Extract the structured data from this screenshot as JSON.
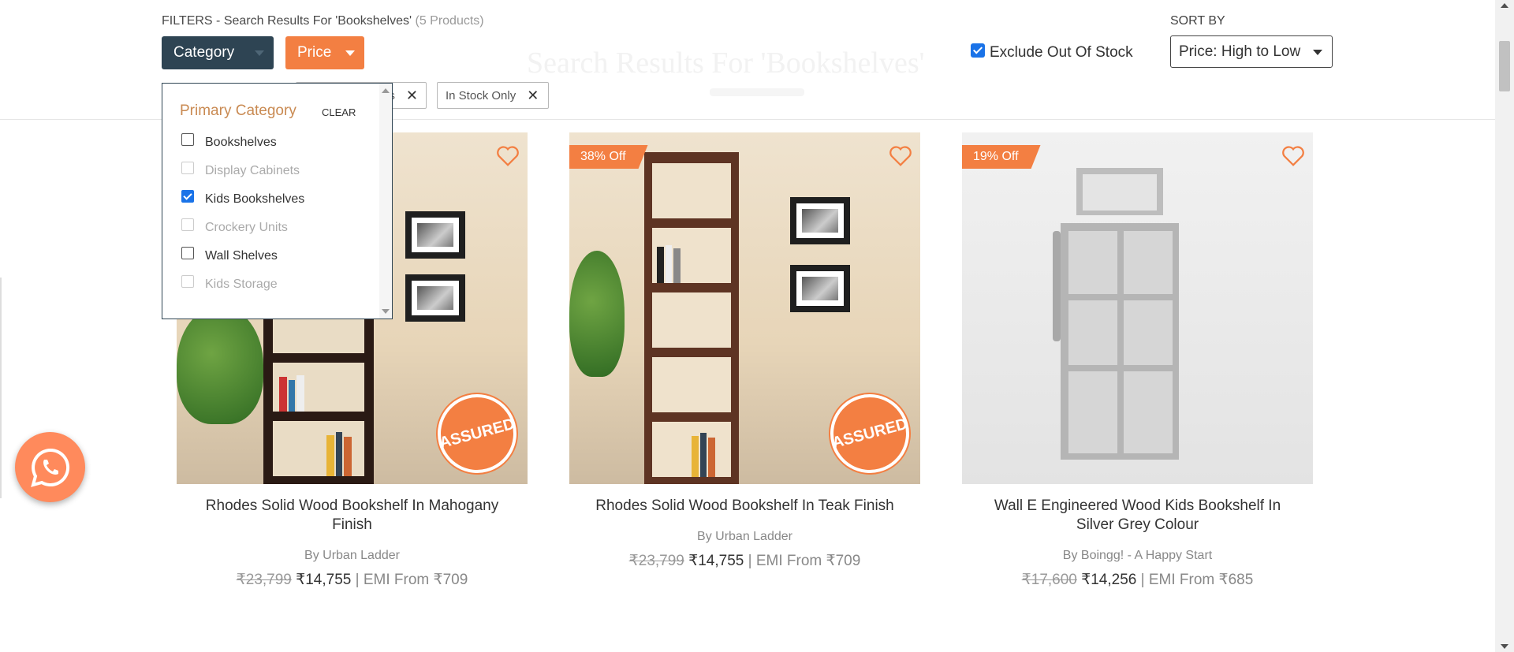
{
  "header": {
    "filters_label": "FILTERS - Search Results For 'Bookshelves'",
    "product_count": "(5 Products)",
    "ghost_title": "Search Results For 'Bookshelves'"
  },
  "filter_buttons": {
    "category": "Category",
    "price": "Price"
  },
  "active_chips": {
    "prev_suffix": "s",
    "in_stock": "In Stock Only"
  },
  "exclude_out_of_stock": {
    "label": "Exclude Out Of Stock",
    "checked": true
  },
  "sort": {
    "label": "SORT BY",
    "value": "Price: High to Low"
  },
  "category_dropdown": {
    "heading": "Primary Category",
    "clear": "CLEAR",
    "items": [
      {
        "label": "Bookshelves",
        "checked": false,
        "disabled": false
      },
      {
        "label": "Display Cabinets",
        "checked": false,
        "disabled": true
      },
      {
        "label": "Kids Bookshelves",
        "checked": true,
        "disabled": false
      },
      {
        "label": "Crockery Units",
        "checked": false,
        "disabled": true
      },
      {
        "label": "Wall Shelves",
        "checked": false,
        "disabled": false
      },
      {
        "label": "Kids Storage",
        "checked": false,
        "disabled": true
      }
    ]
  },
  "products": [
    {
      "discount": "",
      "title": "Rhodes Solid Wood Bookshelf In Mahogany Finish",
      "brand": "By Urban Ladder",
      "old_price": "₹23,799",
      "price": "₹14,755",
      "emi": "| EMI From ₹709",
      "assured": true
    },
    {
      "discount": "38% Off",
      "title": "Rhodes Solid Wood Bookshelf In Teak Finish",
      "brand": "By Urban Ladder",
      "old_price": "₹23,799",
      "price": "₹14,755",
      "emi": "| EMI From ₹709",
      "assured": true
    },
    {
      "discount": "19% Off",
      "title": "Wall E Engineered Wood Kids Bookshelf In Silver Grey Colour",
      "brand": "By Boingg! - A Happy Start",
      "old_price": "₹17,600",
      "price": "₹14,256",
      "emi": "| EMI From ₹685",
      "assured": false
    }
  ],
  "assured_badge": "ASSURED",
  "colors": {
    "category_button": "#2e4453",
    "accent_orange": "#f37f42",
    "checkbox_blue": "#1a73e8",
    "dropdown_heading": "#c98a52"
  },
  "icons": [
    "heart-icon",
    "whatsapp-icon",
    "close-icon",
    "chevron-down-icon"
  ]
}
